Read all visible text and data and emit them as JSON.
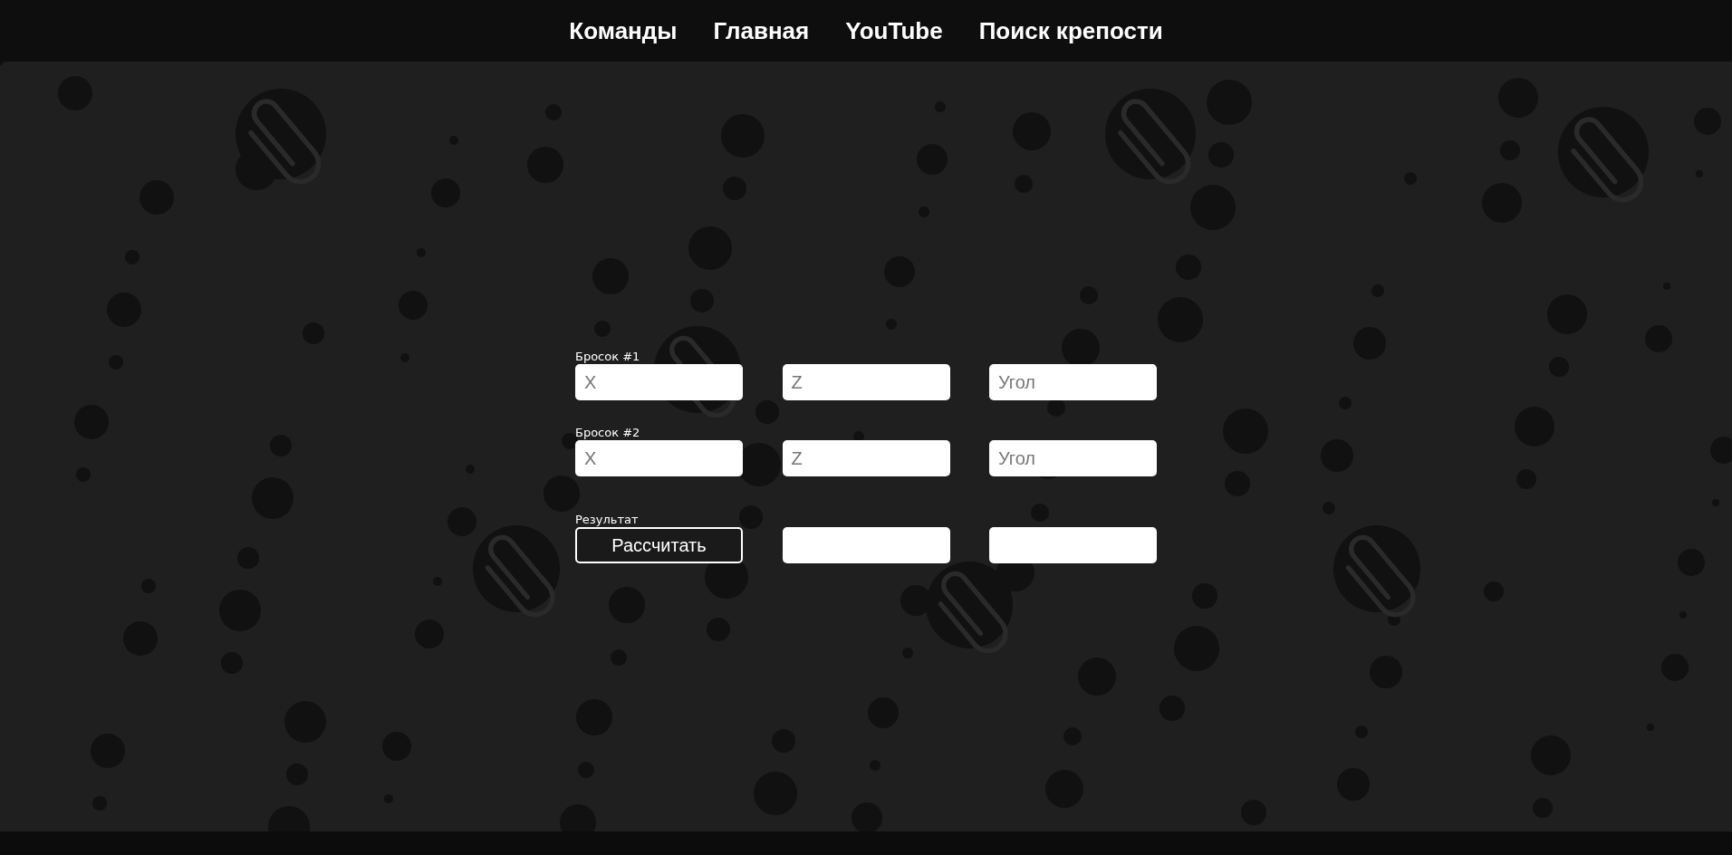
{
  "nav": {
    "links": [
      {
        "label": "Команды"
      },
      {
        "label": "Главная"
      },
      {
        "label": "YouTube"
      },
      {
        "label": "Поиск крепости"
      }
    ]
  },
  "throws": [
    {
      "label": "Бросок #1",
      "fields": [
        {
          "placeholder": "X"
        },
        {
          "placeholder": "Z"
        },
        {
          "placeholder": "Угол"
        }
      ]
    },
    {
      "label": "Бросок #2",
      "fields": [
        {
          "placeholder": "X"
        },
        {
          "placeholder": "Z"
        },
        {
          "placeholder": "Угол"
        }
      ]
    }
  ],
  "result": {
    "label": "Результат",
    "button": "Рассчитать",
    "outputs": [
      {
        "kind": "output"
      },
      {
        "kind": "output"
      }
    ]
  }
}
